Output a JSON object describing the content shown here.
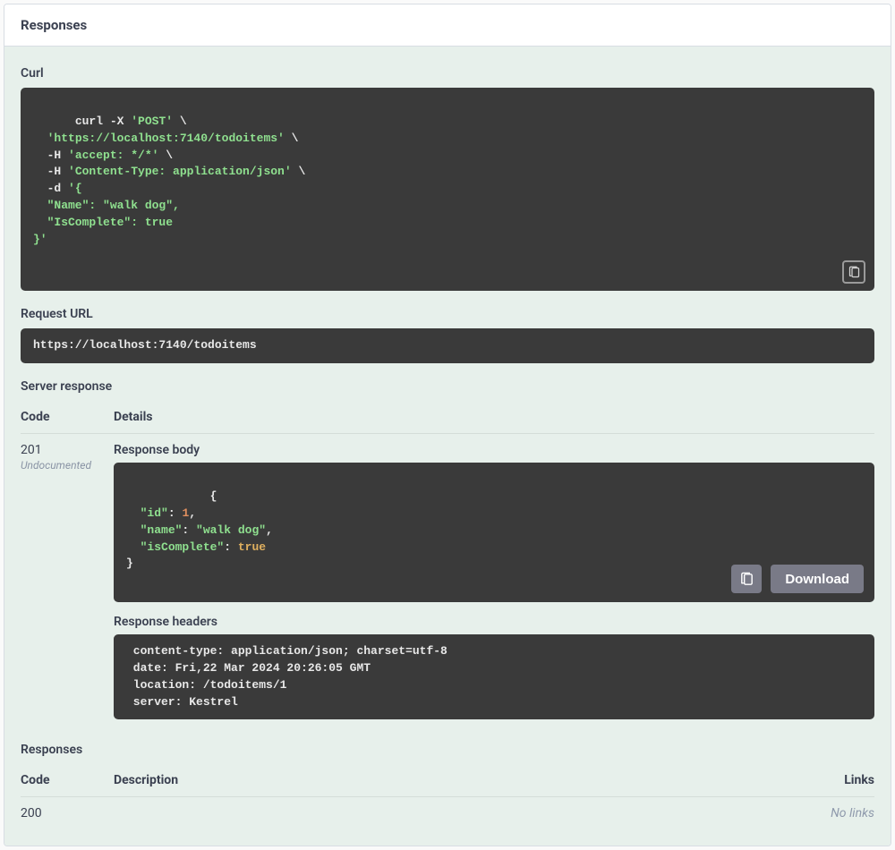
{
  "header": {
    "title": "Responses"
  },
  "curl": {
    "label": "Curl",
    "segments": [
      {
        "t": "curl -X ",
        "c": ""
      },
      {
        "t": "'POST'",
        "c": "hl"
      },
      {
        "t": " \\\n  ",
        "c": ""
      },
      {
        "t": "'https://localhost:7140/todoitems'",
        "c": "hl"
      },
      {
        "t": " \\\n  -H ",
        "c": ""
      },
      {
        "t": "'accept: */*'",
        "c": "hl"
      },
      {
        "t": " \\\n  -H ",
        "c": ""
      },
      {
        "t": "'Content-Type: application/json'",
        "c": "hl"
      },
      {
        "t": " \\\n  -d ",
        "c": ""
      },
      {
        "t": "'{\n  \"Name\": \"walk dog\",\n  \"IsComplete\": true\n}'",
        "c": "hl"
      }
    ]
  },
  "request_url": {
    "label": "Request URL",
    "value": "https://localhost:7140/todoitems"
  },
  "server_response": {
    "label": "Server response",
    "columns": {
      "code": "Code",
      "details": "Details"
    },
    "code": "201",
    "undocumented": "Undocumented",
    "body_label": "Response body",
    "body_segments": [
      {
        "t": "{\n  ",
        "c": ""
      },
      {
        "t": "\"id\"",
        "c": "hl"
      },
      {
        "t": ": ",
        "c": ""
      },
      {
        "t": "1",
        "c": "num"
      },
      {
        "t": ",\n  ",
        "c": ""
      },
      {
        "t": "\"name\"",
        "c": "hl"
      },
      {
        "t": ": ",
        "c": ""
      },
      {
        "t": "\"walk dog\"",
        "c": "hl"
      },
      {
        "t": ",\n  ",
        "c": ""
      },
      {
        "t": "\"isComplete\"",
        "c": "hl"
      },
      {
        "t": ": ",
        "c": ""
      },
      {
        "t": "true",
        "c": "bool"
      },
      {
        "t": "\n}",
        "c": ""
      }
    ],
    "download_label": "Download",
    "headers_label": "Response headers",
    "headers_text": " content-type: application/json; charset=utf-8 \n date: Fri,22 Mar 2024 20:26:05 GMT \n location: /todoitems/1 \n server: Kestrel "
  },
  "documented": {
    "label": "Responses",
    "columns": {
      "code": "Code",
      "description": "Description",
      "links": "Links"
    },
    "rows": [
      {
        "code": "200",
        "description": "",
        "links": "No links"
      }
    ]
  }
}
